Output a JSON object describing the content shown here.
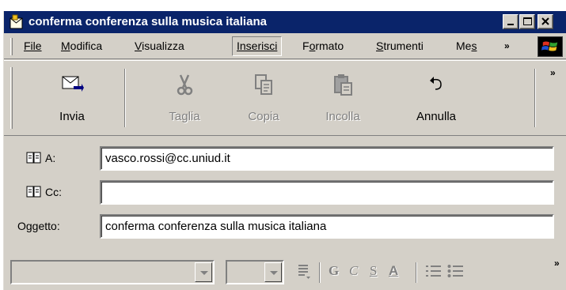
{
  "window": {
    "title": "conferma conferenza sulla musica italiana"
  },
  "menu": {
    "items": [
      {
        "label": "File",
        "hotkey": "F"
      },
      {
        "label": "Modifica",
        "hotkey": "M"
      },
      {
        "label": "Visualizza",
        "hotkey": "V"
      },
      {
        "label": "Inserisci",
        "hotkey": "I"
      },
      {
        "label": "Formato",
        "hotkey": "o"
      },
      {
        "label": "Strumenti",
        "hotkey": "S"
      },
      {
        "label": "Mes",
        "hotkey": "s"
      }
    ],
    "overflow": "»"
  },
  "toolbar": {
    "send_label": "Invia",
    "cut_label": "Taglia",
    "copy_label": "Copia",
    "paste_label": "Incolla",
    "undo_label": "Annulla",
    "overflow": "»"
  },
  "fields": {
    "to_label": "A:",
    "to_value": "vasco.rossi@cc.uniud.it",
    "cc_label": "Cc:",
    "cc_value": "",
    "subject_label": "Oggetto:",
    "subject_value": "conferma conferenza sulla musica italiana"
  },
  "format": {
    "bold": "G",
    "italic": "C",
    "underline": "S",
    "font_color": "A",
    "overflow": "»"
  },
  "icons": {
    "app": "mail-envelope-icon",
    "send": "send-icon",
    "cut": "scissors-icon",
    "copy": "copy-icon",
    "paste": "paste-icon",
    "undo": "undo-icon",
    "address_book": "address-book-icon"
  },
  "colors": {
    "titlebar": "#0a246a",
    "face": "#d4d0c8",
    "disabled_text": "#808080"
  }
}
